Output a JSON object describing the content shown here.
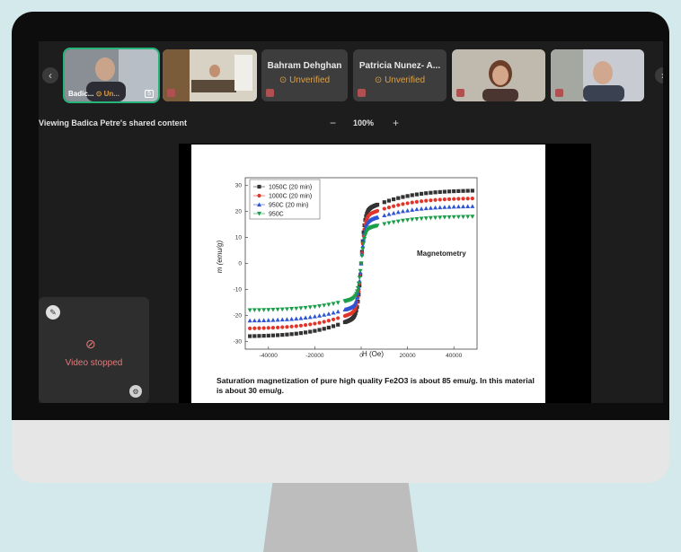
{
  "participants": [
    {
      "name": "Badic...",
      "status": "Un...",
      "badge": "5"
    },
    {
      "name": "",
      "status": ""
    },
    {
      "name": "Bahram Dehghan",
      "status": "Unverified"
    },
    {
      "name": "Patricia Nunez- A...",
      "status": "Unverified"
    },
    {
      "name": "",
      "status": ""
    },
    {
      "name": "",
      "status": ""
    }
  ],
  "share": {
    "label": "Viewing Badica Petre's shared content",
    "zoom": "100%",
    "zoom_minus": "−",
    "zoom_plus": "+"
  },
  "self_view": {
    "status": "Video stopped"
  },
  "slide": {
    "caption": "Saturation magnetization of pure high quality Fe2O3 is about 85 emu/g. In this material is about 30 emu/g."
  },
  "chart_data": {
    "type": "scatter",
    "xlabel": "H (Oe)",
    "ylabel": "m (emu/g)",
    "annotation": "Magnetometry",
    "xlim": [
      -50000,
      50000
    ],
    "ylim": [
      -33,
      33
    ],
    "xticks": [
      "-40000",
      "-20000",
      "0",
      "20000",
      "40000"
    ],
    "yticks": [
      "30",
      "20",
      "10",
      "0",
      "-10",
      "-20",
      "-30"
    ],
    "legend_position": "top-left",
    "series": [
      {
        "name": "1050C (20 min)",
        "color": "#333333",
        "marker": "square",
        "ms": 28
      },
      {
        "name": "1000C (20 min)",
        "color": "#e2352a",
        "marker": "circle",
        "ms": 25
      },
      {
        "name": "950C (20 min)",
        "color": "#2f55d4",
        "marker": "triangle-up",
        "ms": 22
      },
      {
        "name": "950C",
        "color": "#1a9e4a",
        "marker": "triangle-down",
        "ms": 18
      }
    ]
  }
}
